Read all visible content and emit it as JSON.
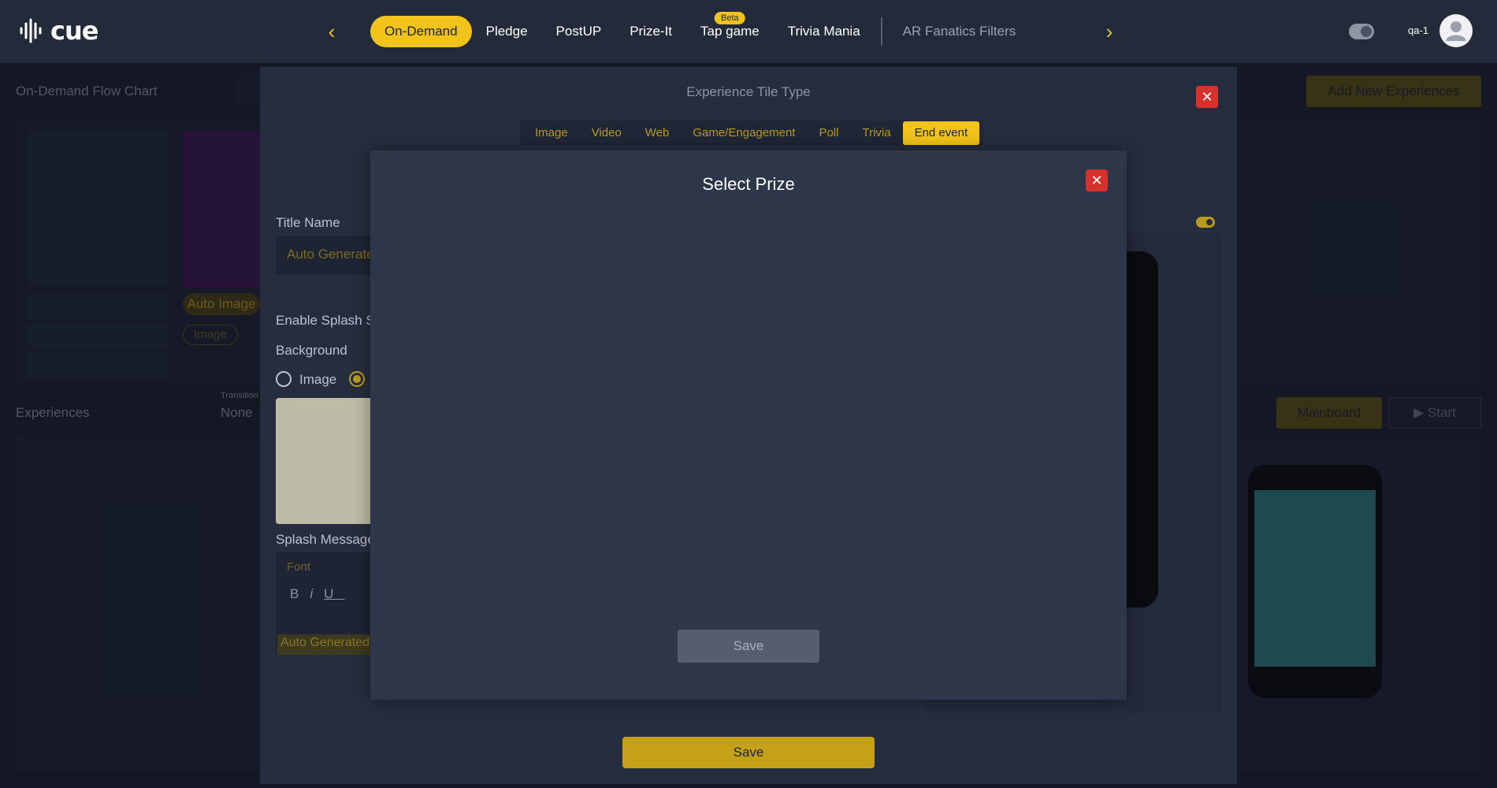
{
  "app": {
    "logo_text": "cue"
  },
  "nav": {
    "tabs": [
      {
        "label": "On-Demand",
        "active": true
      },
      {
        "label": "Pledge"
      },
      {
        "label": "PostUP"
      },
      {
        "label": "Prize-It"
      },
      {
        "label": "Tap game",
        "badge": "Beta"
      },
      {
        "label": "Trivia Mania"
      },
      {
        "label": "AR Fanatics Filters",
        "muted": true
      }
    ],
    "user": "qa-1"
  },
  "background": {
    "flow_chart_title": "On-Demand Flow Chart",
    "add_button": "Add New Experiences",
    "auto_image_label": "Auto Image",
    "image_chip": "Image",
    "experiences_label": "Experiences",
    "transition_label": "Transition",
    "transition_value": "None",
    "mainboard_button": "Mainboard",
    "start_button": "Start"
  },
  "experience_modal": {
    "title": "Experience Tile Type",
    "type_tabs": [
      "Image",
      "Video",
      "Web",
      "Game/Engagement",
      "Poll",
      "Trivia",
      "End event"
    ],
    "active_type": "End event",
    "title_name_label": "Title Name",
    "title_name_placeholder": "Auto Generate",
    "enable_splash_label": "Enable Splash S",
    "background_label": "Background",
    "radio_image_label": "Image",
    "splash_message_label": "Splash Message",
    "font_placeholder": "Font",
    "splash_text": "Auto Generated",
    "save_label": "Save"
  },
  "prize_modal": {
    "title": "Select Prize",
    "save_label": "Save"
  },
  "colors": {
    "accent": "#f2c31a",
    "danger": "#d7312c",
    "background": "#1c2333"
  }
}
